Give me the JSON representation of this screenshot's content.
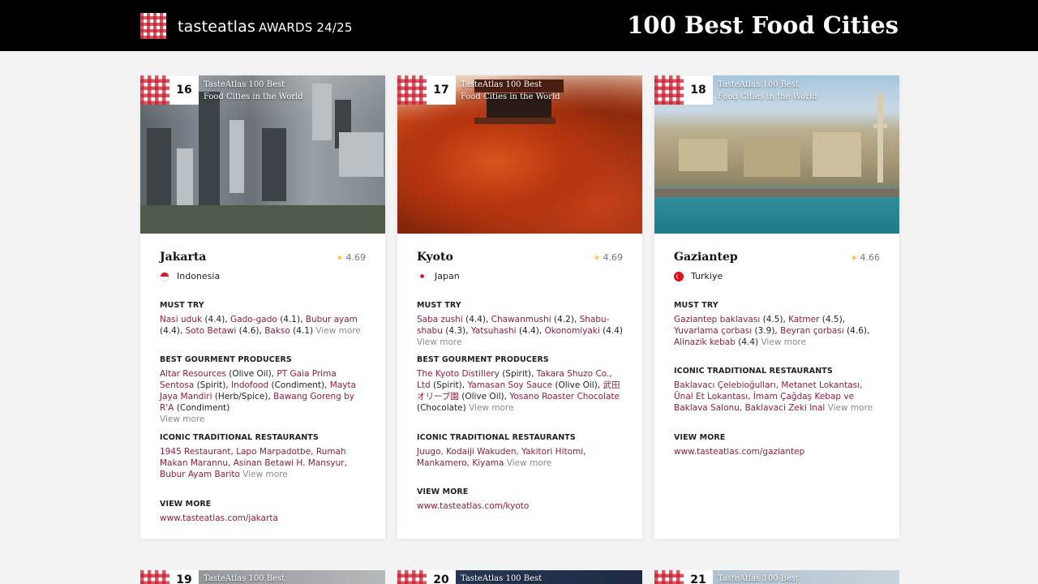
{
  "header": {
    "brand_name": "tasteatlas",
    "brand_sub": "AWARDS 24/25",
    "title": "100 Best Food Cities"
  },
  "badge_text_line1": "TasteAtlas 100 Best",
  "badge_text_line2": "Food Cities in the World",
  "labels": {
    "must_try": "MUST TRY",
    "producers": "BEST GOURMENT PRODUCERS",
    "restaurants": "ICONIC TRADITIONAL RESTAURANTS",
    "view_more_title": "VIEW MORE",
    "view_more_link": "View more"
  },
  "cards": [
    {
      "rank": "16",
      "city": "Jakarta",
      "rating": "4.69",
      "country": "Indonesia",
      "flag": "id",
      "must_try": [
        {
          "name": "Nasi uduk",
          "score": "(4.4),"
        },
        {
          "name": "Gado-gado",
          "score": "(4.1),"
        },
        {
          "name": "Bubur ayam",
          "score": "(4.4),"
        },
        {
          "name": "Soto Betawi",
          "score": "(4.6),"
        },
        {
          "name": "Bakso",
          "score": "(4.1)"
        }
      ],
      "producers": [
        {
          "name": "Altar Resources",
          "type": "(Olive Oil),"
        },
        {
          "name": "PT Gaia Prima Sentosa",
          "type": "(Spirit),"
        },
        {
          "name": "Indofood",
          "type": "(Condiment),"
        },
        {
          "name": "Mayta Jaya Mandiri",
          "type": "(Herb/Spice),"
        },
        {
          "name": "Bawang Goreng by R'A",
          "type": "(Condiment)"
        }
      ],
      "restaurants": "1945 Restaurant, Lapo Marpadotbe, Rumah Makan Marannu, Asinan Betawi H. Mansyur, Bubur Ayam Barito",
      "url": "www.tasteatlas.com/jakarta"
    },
    {
      "rank": "17",
      "city": "Kyoto",
      "rating": "4.69",
      "country": "Japan",
      "flag": "jp",
      "must_try": [
        {
          "name": "Saba zushi",
          "score": "(4.4),"
        },
        {
          "name": "Chawanmushi",
          "score": "(4.2),"
        },
        {
          "name": "Shabu-shabu",
          "score": "(4.3),"
        },
        {
          "name": "Yatsuhashi",
          "score": "(4.4),"
        },
        {
          "name": "Okonomiyaki",
          "score": "(4.4)"
        }
      ],
      "producers": [
        {
          "name": "The Kyoto Distillery",
          "type": "(Spirit),"
        },
        {
          "name": "Takara Shuzo Co., Ltd",
          "type": "(Spirit),"
        },
        {
          "name": "Yamasan Soy Sauce",
          "type": "(Olive Oil),"
        },
        {
          "name": "武田オリーブ園",
          "type": "(Olive Oil),"
        },
        {
          "name": "Yosano Roaster Chocolate",
          "type": "(Chocolate)"
        }
      ],
      "restaurants": "Juugo, Kodaiji Wakuden, Yakitori Hitomi, Mankamero, Kiyama",
      "url": "www.tasteatlas.com/kyoto"
    },
    {
      "rank": "18",
      "city": "Gaziantep",
      "rating": "4.66",
      "country": "Turkiye",
      "flag": "tr",
      "must_try": [
        {
          "name": "Gaziantep baklavası",
          "score": "(4.5),"
        },
        {
          "name": "Katmer",
          "score": "(4.5),"
        },
        {
          "name": "Yuvarlama çorbası",
          "score": "(3.9),"
        },
        {
          "name": "Beyran çorbası",
          "score": "(4.6),"
        },
        {
          "name": "Alinazik kebab",
          "score": "(4.4)"
        }
      ],
      "restaurants": "Baklavacı Çelebioğulları, Metanet Lokantası, Ünal Et Lokantası, İmam Çağdaş Kebap ve Baklava Salonu, Baklavaci Zeki Inal",
      "url": "www.tasteatlas.com/gaziantep"
    }
  ],
  "next_row": {
    "ranks": [
      "19",
      "20",
      "21"
    ]
  }
}
